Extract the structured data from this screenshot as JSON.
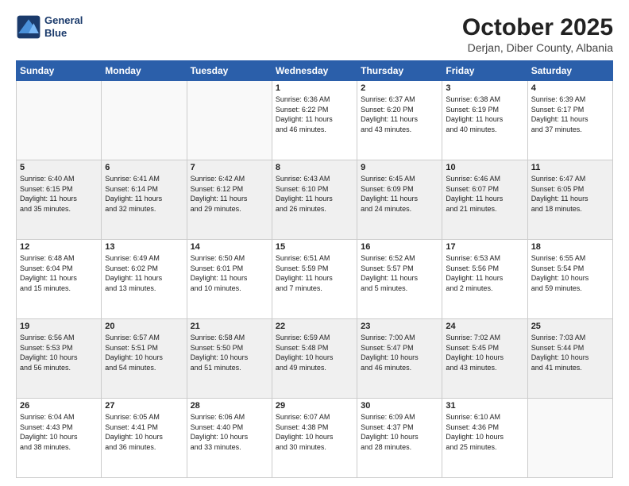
{
  "header": {
    "logo_line1": "General",
    "logo_line2": "Blue",
    "month": "October 2025",
    "location": "Derjan, Diber County, Albania"
  },
  "weekdays": [
    "Sunday",
    "Monday",
    "Tuesday",
    "Wednesday",
    "Thursday",
    "Friday",
    "Saturday"
  ],
  "weeks": [
    [
      {
        "day": "",
        "info": ""
      },
      {
        "day": "",
        "info": ""
      },
      {
        "day": "",
        "info": ""
      },
      {
        "day": "1",
        "info": "Sunrise: 6:36 AM\nSunset: 6:22 PM\nDaylight: 11 hours\nand 46 minutes."
      },
      {
        "day": "2",
        "info": "Sunrise: 6:37 AM\nSunset: 6:20 PM\nDaylight: 11 hours\nand 43 minutes."
      },
      {
        "day": "3",
        "info": "Sunrise: 6:38 AM\nSunset: 6:19 PM\nDaylight: 11 hours\nand 40 minutes."
      },
      {
        "day": "4",
        "info": "Sunrise: 6:39 AM\nSunset: 6:17 PM\nDaylight: 11 hours\nand 37 minutes."
      }
    ],
    [
      {
        "day": "5",
        "info": "Sunrise: 6:40 AM\nSunset: 6:15 PM\nDaylight: 11 hours\nand 35 minutes."
      },
      {
        "day": "6",
        "info": "Sunrise: 6:41 AM\nSunset: 6:14 PM\nDaylight: 11 hours\nand 32 minutes."
      },
      {
        "day": "7",
        "info": "Sunrise: 6:42 AM\nSunset: 6:12 PM\nDaylight: 11 hours\nand 29 minutes."
      },
      {
        "day": "8",
        "info": "Sunrise: 6:43 AM\nSunset: 6:10 PM\nDaylight: 11 hours\nand 26 minutes."
      },
      {
        "day": "9",
        "info": "Sunrise: 6:45 AM\nSunset: 6:09 PM\nDaylight: 11 hours\nand 24 minutes."
      },
      {
        "day": "10",
        "info": "Sunrise: 6:46 AM\nSunset: 6:07 PM\nDaylight: 11 hours\nand 21 minutes."
      },
      {
        "day": "11",
        "info": "Sunrise: 6:47 AM\nSunset: 6:05 PM\nDaylight: 11 hours\nand 18 minutes."
      }
    ],
    [
      {
        "day": "12",
        "info": "Sunrise: 6:48 AM\nSunset: 6:04 PM\nDaylight: 11 hours\nand 15 minutes."
      },
      {
        "day": "13",
        "info": "Sunrise: 6:49 AM\nSunset: 6:02 PM\nDaylight: 11 hours\nand 13 minutes."
      },
      {
        "day": "14",
        "info": "Sunrise: 6:50 AM\nSunset: 6:01 PM\nDaylight: 11 hours\nand 10 minutes."
      },
      {
        "day": "15",
        "info": "Sunrise: 6:51 AM\nSunset: 5:59 PM\nDaylight: 11 hours\nand 7 minutes."
      },
      {
        "day": "16",
        "info": "Sunrise: 6:52 AM\nSunset: 5:57 PM\nDaylight: 11 hours\nand 5 minutes."
      },
      {
        "day": "17",
        "info": "Sunrise: 6:53 AM\nSunset: 5:56 PM\nDaylight: 11 hours\nand 2 minutes."
      },
      {
        "day": "18",
        "info": "Sunrise: 6:55 AM\nSunset: 5:54 PM\nDaylight: 10 hours\nand 59 minutes."
      }
    ],
    [
      {
        "day": "19",
        "info": "Sunrise: 6:56 AM\nSunset: 5:53 PM\nDaylight: 10 hours\nand 56 minutes."
      },
      {
        "day": "20",
        "info": "Sunrise: 6:57 AM\nSunset: 5:51 PM\nDaylight: 10 hours\nand 54 minutes."
      },
      {
        "day": "21",
        "info": "Sunrise: 6:58 AM\nSunset: 5:50 PM\nDaylight: 10 hours\nand 51 minutes."
      },
      {
        "day": "22",
        "info": "Sunrise: 6:59 AM\nSunset: 5:48 PM\nDaylight: 10 hours\nand 49 minutes."
      },
      {
        "day": "23",
        "info": "Sunrise: 7:00 AM\nSunset: 5:47 PM\nDaylight: 10 hours\nand 46 minutes."
      },
      {
        "day": "24",
        "info": "Sunrise: 7:02 AM\nSunset: 5:45 PM\nDaylight: 10 hours\nand 43 minutes."
      },
      {
        "day": "25",
        "info": "Sunrise: 7:03 AM\nSunset: 5:44 PM\nDaylight: 10 hours\nand 41 minutes."
      }
    ],
    [
      {
        "day": "26",
        "info": "Sunrise: 6:04 AM\nSunset: 4:43 PM\nDaylight: 10 hours\nand 38 minutes."
      },
      {
        "day": "27",
        "info": "Sunrise: 6:05 AM\nSunset: 4:41 PM\nDaylight: 10 hours\nand 36 minutes."
      },
      {
        "day": "28",
        "info": "Sunrise: 6:06 AM\nSunset: 4:40 PM\nDaylight: 10 hours\nand 33 minutes."
      },
      {
        "day": "29",
        "info": "Sunrise: 6:07 AM\nSunset: 4:38 PM\nDaylight: 10 hours\nand 30 minutes."
      },
      {
        "day": "30",
        "info": "Sunrise: 6:09 AM\nSunset: 4:37 PM\nDaylight: 10 hours\nand 28 minutes."
      },
      {
        "day": "31",
        "info": "Sunrise: 6:10 AM\nSunset: 4:36 PM\nDaylight: 10 hours\nand 25 minutes."
      },
      {
        "day": "",
        "info": ""
      }
    ]
  ]
}
